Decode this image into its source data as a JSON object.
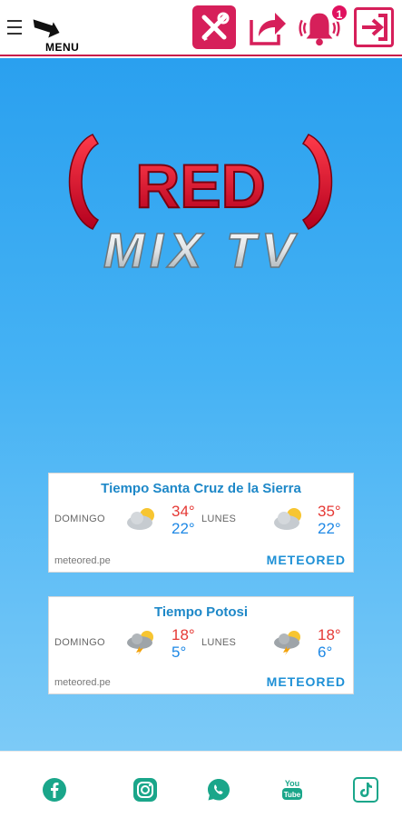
{
  "header": {
    "menu_label": "MENU",
    "notification_count": "1"
  },
  "brand": {
    "logo_top": "RED",
    "logo_bottom": "MIX TV",
    "primary_color": "#d61f5a"
  },
  "weather_widgets": [
    {
      "title": "Tiempo Santa Cruz de la Sierra",
      "days": [
        {
          "day": "DOMINGO",
          "high": "34°",
          "low": "22°",
          "icon": "partly-cloudy-icon"
        },
        {
          "day": "LUNES",
          "high": "35°",
          "low": "22°",
          "icon": "partly-cloudy-icon"
        }
      ],
      "source": "meteored.pe",
      "brand": "METEORED"
    },
    {
      "title": "Tiempo Potosi",
      "days": [
        {
          "day": "DOMINGO",
          "high": "18°",
          "low": "5°",
          "icon": "storm-icon"
        },
        {
          "day": "LUNES",
          "high": "18°",
          "low": "6°",
          "icon": "storm-icon"
        }
      ],
      "source": "meteored.pe",
      "brand": "METEORED"
    }
  ],
  "footer": {
    "social_icons": [
      "facebook-icon",
      "instagram-icon",
      "whatsapp-icon",
      "youtube-icon",
      "tiktok-icon"
    ],
    "social_color": "#1aa68a",
    "youtube_text": "You Tube"
  }
}
